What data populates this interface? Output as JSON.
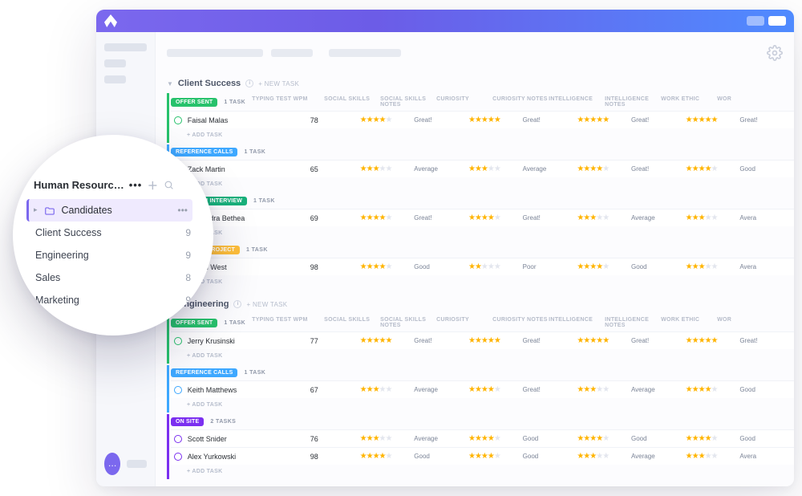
{
  "columns": [
    "TYPING TEST WPM",
    "SOCIAL SKILLS",
    "SOCIAL SKILLS NOTES",
    "CURIOSITY",
    "CURIOSITY NOTES",
    "INTELLIGENCE",
    "INTELLIGENCE NOTES",
    "WORK ETHIC",
    "WOR"
  ],
  "lens": {
    "title": "Human Resourc…",
    "items": [
      {
        "label": "Candidates",
        "count": "•••",
        "active": true
      },
      {
        "label": "Client Success",
        "count": "9"
      },
      {
        "label": "Engineering",
        "count": "9"
      },
      {
        "label": "Sales",
        "count": "8"
      },
      {
        "label": "Marketing",
        "count": "9"
      }
    ]
  },
  "ui": {
    "new_task": "+ NEW TASK",
    "add_task": "+ ADD TASK"
  },
  "sections": [
    {
      "title": "Client Success",
      "groups": [
        {
          "label": "OFFER SENT",
          "count": "1 TASK",
          "color": "#27c26c",
          "rows": [
            {
              "name": "Faisal Malas",
              "wpm": "78",
              "cells": [
                {
                  "s": 4,
                  "n": "Great!"
                },
                {
                  "s": 5,
                  "n": "Great!"
                },
                {
                  "s": 5,
                  "n": "Great!"
                },
                {
                  "s": 5,
                  "n": "Great!"
                }
              ]
            }
          ]
        },
        {
          "label": "REFERENCE CALLS",
          "count": "1 TASK",
          "color": "#3ea8ff",
          "rows": [
            {
              "name": "Zack Martin",
              "wpm": "65",
              "cells": [
                {
                  "s": 3,
                  "n": "Average"
                },
                {
                  "s": 3,
                  "n": "Average"
                },
                {
                  "s": 4,
                  "n": "Great!"
                },
                {
                  "s": 4,
                  "n": "Good"
                }
              ]
            }
          ]
        },
        {
          "label": "IN PERSON INTERVIEW",
          "count": "1 TASK",
          "color": "#18b07b",
          "rows": [
            {
              "name": "Alexandra Bethea",
              "wpm": "69",
              "cells": [
                {
                  "s": 4,
                  "n": "Great!"
                },
                {
                  "s": 4,
                  "n": "Great!"
                },
                {
                  "s": 3,
                  "n": "Average"
                },
                {
                  "s": 3,
                  "n": "Avera"
                }
              ]
            }
          ]
        },
        {
          "label": "RECEIVED PROJECT",
          "count": "1 TASK",
          "color": "#ffbf3a",
          "text": "#fff",
          "rows": [
            {
              "name": "Brandi West",
              "wpm": "98",
              "cells": [
                {
                  "s": 4,
                  "n": "Good"
                },
                {
                  "s": 2,
                  "n": "Poor"
                },
                {
                  "s": 4,
                  "n": "Good"
                },
                {
                  "s": 3,
                  "n": "Avera"
                }
              ]
            }
          ]
        }
      ]
    },
    {
      "title": "Engineering",
      "groups": [
        {
          "label": "OFFER SENT",
          "count": "1 TASK",
          "color": "#27c26c",
          "rows": [
            {
              "name": "Jerry Krusinski",
              "wpm": "77",
              "cells": [
                {
                  "s": 5,
                  "n": "Great!"
                },
                {
                  "s": 5,
                  "n": "Great!"
                },
                {
                  "s": 5,
                  "n": "Great!"
                },
                {
                  "s": 5,
                  "n": "Great!"
                }
              ]
            }
          ]
        },
        {
          "label": "REFERENCE CALLS",
          "count": "1 TASK",
          "color": "#3ea8ff",
          "rows": [
            {
              "name": "Keith Matthews",
              "wpm": "67",
              "cells": [
                {
                  "s": 3,
                  "n": "Average"
                },
                {
                  "s": 4,
                  "n": "Great!"
                },
                {
                  "s": 3,
                  "n": "Average"
                },
                {
                  "s": 4,
                  "n": "Good"
                }
              ]
            }
          ]
        },
        {
          "label": "ON SITE",
          "count": "2 TASKS",
          "color": "#7b2ff0",
          "rows": [
            {
              "name": "Scott Snider",
              "wpm": "76",
              "cells": [
                {
                  "s": 3,
                  "n": "Average"
                },
                {
                  "s": 4,
                  "n": "Good"
                },
                {
                  "s": 4,
                  "n": "Good"
                },
                {
                  "s": 4,
                  "n": "Good"
                }
              ]
            },
            {
              "name": "Alex Yurkowski",
              "wpm": "98",
              "cells": [
                {
                  "s": 4,
                  "n": "Good"
                },
                {
                  "s": 4,
                  "n": "Good"
                },
                {
                  "s": 3,
                  "n": "Average"
                },
                {
                  "s": 3,
                  "n": "Avera"
                }
              ]
            }
          ]
        }
      ]
    }
  ]
}
